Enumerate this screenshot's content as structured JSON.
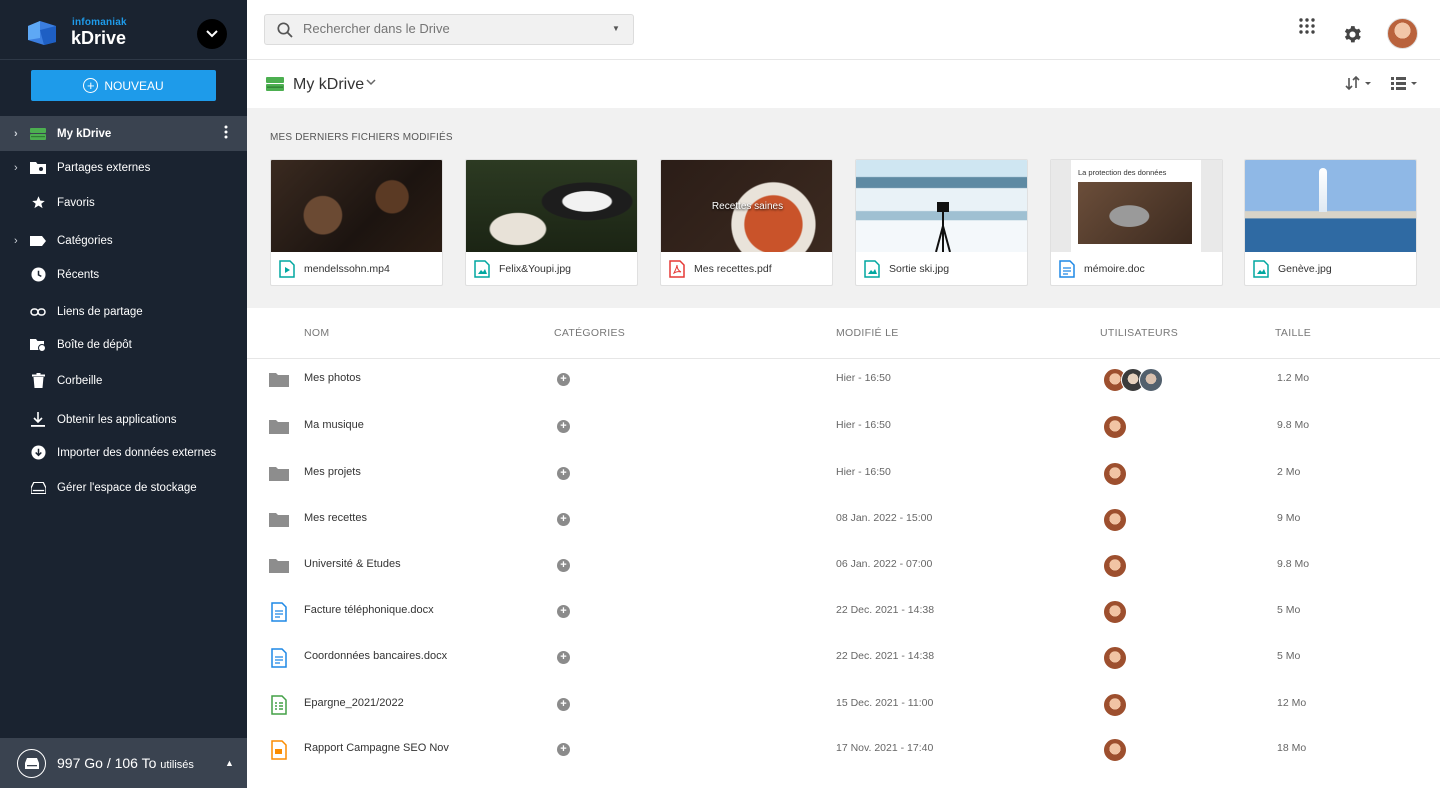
{
  "brand": {
    "company": "infomaniak",
    "product": "kDrive"
  },
  "sidebar": {
    "new_button": "NOUVEAU",
    "items": [
      {
        "label": "My kDrive",
        "icon": "drive-icon",
        "active": true
      },
      {
        "label": "Partages externes",
        "icon": "shared-folder-icon"
      },
      {
        "label": "Favoris",
        "icon": "star-icon"
      },
      {
        "label": "Catégories",
        "icon": "label-icon"
      },
      {
        "label": "Récents",
        "icon": "clock-icon"
      },
      {
        "label": "Liens de partage",
        "icon": "link-icon"
      },
      {
        "label": "Boîte de dépôt",
        "icon": "dropbox-folder-icon"
      },
      {
        "label": "Corbeille",
        "icon": "trash-icon"
      },
      {
        "label": "Obtenir les applications",
        "icon": "download-icon"
      },
      {
        "label": "Importer des données externes",
        "icon": "import-icon"
      },
      {
        "label": "Gérer l'espace de stockage",
        "icon": "storage-icon"
      }
    ],
    "storage_used": "997 Go / 106 To",
    "storage_suffix": "utilisés"
  },
  "search": {
    "placeholder": "Rechercher dans le Drive"
  },
  "header": {
    "title": "My kDrive"
  },
  "recent": {
    "title": "MES DERNIERS FICHIERS MODIFIÉS",
    "files": [
      {
        "name": "mendelssohn.mp4",
        "type": "video",
        "thumb_text": ""
      },
      {
        "name": "Felix&Youpi.jpg",
        "type": "image",
        "thumb_text": ""
      },
      {
        "name": "Mes recettes.pdf",
        "type": "pdf",
        "thumb_text": "Recettes saines"
      },
      {
        "name": "Sortie ski.jpg",
        "type": "image",
        "thumb_text": ""
      },
      {
        "name": "mémoire.doc",
        "type": "doc",
        "thumb_text": "La protection des données"
      },
      {
        "name": "Genève.jpg",
        "type": "image",
        "thumb_text": ""
      }
    ]
  },
  "table": {
    "columns": {
      "name": "NOM",
      "categories": "CATÉGORIES",
      "modified": "MODIFIÉ LE",
      "users": "UTILISATEURS",
      "size": "TAILLE"
    },
    "rows": [
      {
        "name": "Mes photos",
        "type": "folder",
        "modified": "Hier - 16:50",
        "users": 3,
        "size": "1.2 Mo"
      },
      {
        "name": "Ma musique",
        "type": "folder",
        "modified": "Hier - 16:50",
        "users": 1,
        "size": "9.8 Mo"
      },
      {
        "name": "Mes projets",
        "type": "folder",
        "modified": "Hier - 16:50",
        "users": 1,
        "size": "2 Mo"
      },
      {
        "name": "Mes recettes",
        "type": "folder",
        "modified": "08 Jan. 2022 - 15:00",
        "users": 1,
        "size": "9 Mo"
      },
      {
        "name": "Université & Etudes",
        "type": "folder",
        "modified": "06 Jan. 2022 - 07:00",
        "users": 1,
        "size": "9.8 Mo"
      },
      {
        "name": "Facture téléphonique.docx",
        "type": "doc",
        "modified": "22 Dec. 2021 - 14:38",
        "users": 1,
        "size": "5 Mo"
      },
      {
        "name": "Coordonnées bancaires.docx",
        "type": "doc",
        "modified": "22 Dec. 2021 - 14:38",
        "users": 1,
        "size": "5 Mo"
      },
      {
        "name": "Epargne_2021/2022",
        "type": "sheet",
        "modified": "15 Dec. 2021 - 11:00",
        "users": 1,
        "size": "12 Mo"
      },
      {
        "name": "Rapport Campagne SEO Nov",
        "type": "slides",
        "modified": "17 Nov. 2021 - 17:40",
        "users": 1,
        "size": "18 Mo"
      }
    ]
  },
  "colors": {
    "accent": "#1e9bea",
    "sidebar": "#1a2330",
    "drive_green": "#4caf50",
    "folder": "#8d8d8d"
  }
}
